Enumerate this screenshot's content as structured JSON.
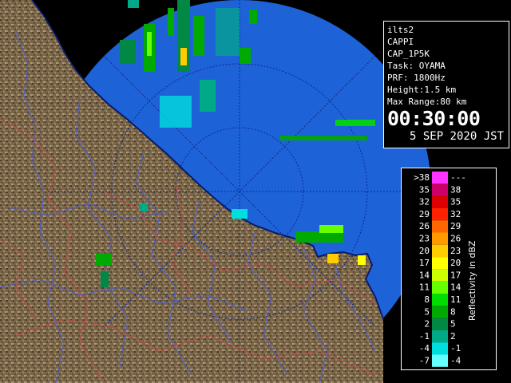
{
  "info": {
    "lines": [
      "ilts2",
      "CAPPI",
      "CAP_1P5K",
      "Task: OYAMA",
      "PRF: 1800Hz",
      "Height:1.5 km",
      "Max Range:80 km"
    ],
    "time": "00:30:00",
    "date": "5 SEP 2020 JST"
  },
  "legend": {
    "title": "Reflectivity in dBZ",
    "rows": [
      {
        "left": ">38",
        "right": "---",
        "color": "#ff33ff"
      },
      {
        "left": "35",
        "right": "38",
        "color": "#cc0066"
      },
      {
        "left": "32",
        "right": "35",
        "color": "#dd0000"
      },
      {
        "left": "29",
        "right": "32",
        "color": "#ff2200"
      },
      {
        "left": "26",
        "right": "29",
        "color": "#ff6600"
      },
      {
        "left": "23",
        "right": "26",
        "color": "#ff9900"
      },
      {
        "left": "20",
        "right": "23",
        "color": "#ffcc00"
      },
      {
        "left": "17",
        "right": "20",
        "color": "#ffff00"
      },
      {
        "left": "14",
        "right": "17",
        "color": "#ccff00"
      },
      {
        "left": "11",
        "right": "14",
        "color": "#66ff00"
      },
      {
        "left": "8",
        "right": "11",
        "color": "#00dd00"
      },
      {
        "left": "5",
        "right": "8",
        "color": "#00aa00"
      },
      {
        "left": "2",
        "right": "5",
        "color": "#008844"
      },
      {
        "left": "-1",
        "right": "2",
        "color": "#00aa88"
      },
      {
        "left": "-4",
        "right": "-1",
        "color": "#00dddd"
      },
      {
        "left": "-7",
        "right": "-4",
        "color": "#66ffff"
      }
    ]
  },
  "colors": {
    "sea_coverage": "#1e62d8",
    "land": "#7a6548",
    "coastline": "#0a1a66",
    "rivers": "#4a5fd0",
    "boundaries": "#c24a4a",
    "range_rings": "#0b2a8c"
  }
}
